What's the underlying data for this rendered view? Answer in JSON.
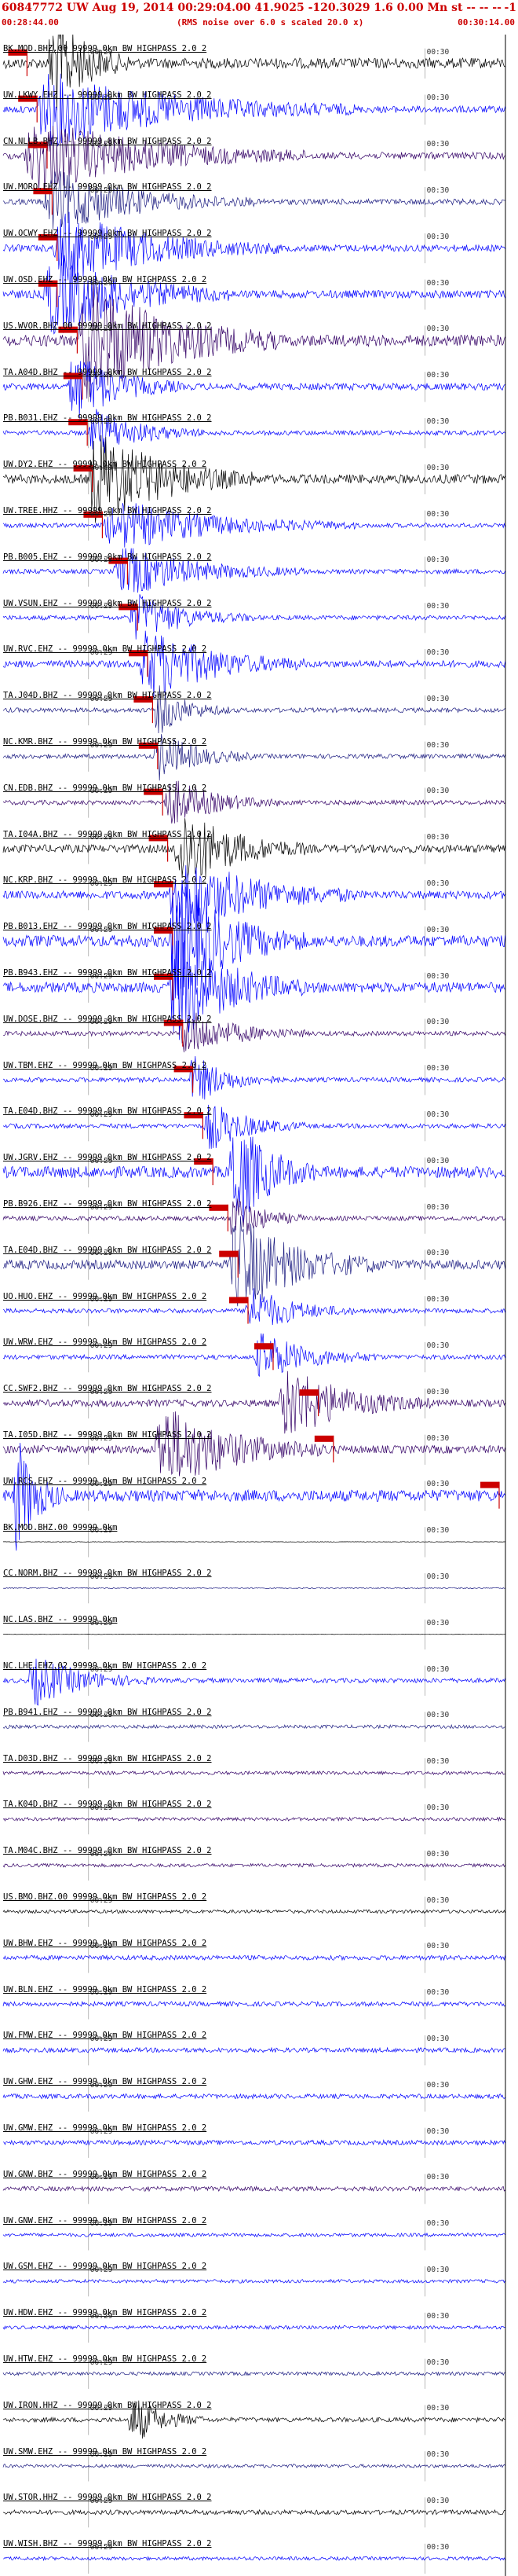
{
  "header": {
    "title": "60847772 UW Aug 19, 2014 00:29:04.00   41.9025 -120.3029   1.6 0.00 Mn st -- -- --",
    "right_mark": "-1",
    "start_time": "00:28:44.00",
    "noise_note": "(RMS noise over 6.0 s scaled 20.0 x)",
    "end_time": "00:30:14.00"
  },
  "tick_labels": {
    "mark1": "00:29",
    "mark2": "00:30"
  },
  "colors": {
    "black": "#000000",
    "blue": "#0000ff",
    "purple": "#330066",
    "navy": "#1a1a80",
    "pick": "#cc0000",
    "grid": "#000000"
  },
  "traces": [
    {
      "label": "BK.MOD.BHZ.00 99999.0km BW  HIGHPASS  2.0  2",
      "color": "black",
      "amp": 0.45,
      "event": [
        0.09,
        0.25
      ],
      "pick": 0.01
    },
    {
      "label": "UW.LKWY.EHZ -- 99999.0km BW  HIGHPASS  2.0  2",
      "color": "blue",
      "amp": 0.3,
      "event": [
        0.06,
        0.7
      ],
      "pick": 0.03
    },
    {
      "label": "CN.NLLB.BHZ -- 99999.0km BW  HIGHPASS  2.0  2",
      "color": "purple",
      "amp": 0.3,
      "event": [
        0.04,
        0.6
      ],
      "pick": 0.05
    },
    {
      "label": "UW.MORO.EHZ -- 99999.0km BW  HIGHPASS  2.0  2",
      "color": "navy",
      "amp": 0.25,
      "event": [
        0.08,
        0.5
      ],
      "pick": 0.06
    },
    {
      "label": "UW.OCWY.EHZ -- 99999.0km BW  HIGHPASS  2.0  2",
      "color": "blue",
      "amp": 0.3,
      "event": [
        0.1,
        0.55
      ],
      "pick": 0.07
    },
    {
      "label": "UW.OSD.EHZ -- 99999.0km BW  HIGHPASS  2.0  2",
      "color": "blue",
      "amp": 0.35,
      "event": [
        0.08,
        0.45
      ],
      "pick": 0.07
    },
    {
      "label": "US.WVOR.BHZ.00 99999.0km BW  HIGHPASS  2.0  2",
      "color": "purple",
      "amp": 0.5,
      "event": [
        0.15,
        0.55
      ],
      "pick": 0.11
    },
    {
      "label": "TA.A04D.BHZ -- 99999.0km BW  HIGHPASS  2.0  2",
      "color": "blue",
      "amp": 0.3,
      "event": [
        0.13,
        0.35
      ],
      "pick": 0.12
    },
    {
      "label": "PB.B031.EHZ -- 99999.0km BW  HIGHPASS  2.0  2",
      "color": "blue",
      "amp": 0.2,
      "event": [
        0.17,
        0.4
      ],
      "pick": 0.13
    },
    {
      "label": "UW.DY2.EHZ -- 99999.0km BW  HIGHPASS  2.0  2",
      "color": "black",
      "amp": 0.4,
      "event": [
        0.17,
        0.5
      ],
      "pick": 0.14
    },
    {
      "label": "UW.TREE.HHZ -- 99999.0km BW  HIGHPASS  2.0  2",
      "color": "blue",
      "amp": 0.2,
      "event": [
        0.2,
        0.7
      ],
      "pick": 0.16
    },
    {
      "label": "PB.B005.EHZ -- 99999.0km BW  HIGHPASS  2.0  2",
      "color": "blue",
      "amp": 0.2,
      "event": [
        0.22,
        0.6
      ],
      "pick": 0.21
    },
    {
      "label": "UW.VSUN.EHZ -- 99999.0km BW  HIGHPASS  2.0  2",
      "color": "blue",
      "amp": 0.2,
      "event": [
        0.25,
        0.5
      ],
      "pick": 0.23
    },
    {
      "label": "UW.RVC.EHZ -- 99999.0km BW  HIGHPASS  2.0  2",
      "color": "blue",
      "amp": 0.3,
      "event": [
        0.27,
        0.6
      ],
      "pick": 0.25
    },
    {
      "label": "TA.J04D.BHZ -- 99999.0km BW  HIGHPASS  2.0  2",
      "color": "navy",
      "amp": 0.2,
      "event": [
        0.3,
        0.45
      ],
      "pick": 0.26
    },
    {
      "label": "NC.KMR.BHZ -- 99999.0km BW  HIGHPASS  2.0  2",
      "color": "navy",
      "amp": 0.2,
      "event": [
        0.3,
        0.5
      ],
      "pick": 0.27
    },
    {
      "label": "CN.EDB.BHZ -- 99999.0km BW  HIGHPASS  2.0  2",
      "color": "purple",
      "amp": 0.2,
      "event": [
        0.32,
        0.55
      ],
      "pick": 0.28
    },
    {
      "label": "TA.I04A.BHZ -- 99999.0km BW  HIGHPASS  2.0  2",
      "color": "black",
      "amp": 0.35,
      "event": [
        0.34,
        0.6
      ],
      "pick": 0.29
    },
    {
      "label": "NC.KRP.BHZ -- 99999.0km BW  HIGHPASS  2.0  2",
      "color": "blue",
      "amp": 0.35,
      "event": [
        0.33,
        0.7
      ],
      "pick": 0.3
    },
    {
      "label": "PB.B013.EHZ -- 99999.0km BW  HIGHPASS  2.0  2",
      "color": "blue",
      "amp": 0.5,
      "event": [
        0.33,
        0.6
      ],
      "pick": 0.3
    },
    {
      "label": "PB.B943.EHZ -- 99999.0km BW  HIGHPASS  2.0  2",
      "color": "blue",
      "amp": 0.45,
      "event": [
        0.33,
        0.6
      ],
      "pick": 0.3
    },
    {
      "label": "UW.DOSE.BHZ -- 99999.0km BW  HIGHPASS  2.0  2",
      "color": "purple",
      "amp": 0.2,
      "event": [
        0.35,
        0.6
      ],
      "pick": 0.32
    },
    {
      "label": "UW.TBM.EHZ -- 99999.0km BW  HIGHPASS  2.0  2",
      "color": "blue",
      "amp": 0.2,
      "event": [
        0.37,
        0.55
      ],
      "pick": 0.34
    },
    {
      "label": "TA.E04D.BHZ -- 99999.0km BW  HIGHPASS  2.0  2",
      "color": "blue",
      "amp": 0.2,
      "event": [
        0.4,
        0.6
      ],
      "pick": 0.36
    },
    {
      "label": "UW.JGRV.EHZ -- 99999.0km BW  HIGHPASS  2.0  2",
      "color": "blue",
      "amp": 0.5,
      "event": [
        0.45,
        0.62
      ],
      "pick": 0.38
    },
    {
      "label": "PB.B926.EHZ -- 99999.0km BW  HIGHPASS  2.0  2",
      "color": "purple",
      "amp": 0.2,
      "event": [
        0.45,
        0.6
      ],
      "pick": 0.41
    },
    {
      "label": "TA.E04D.BHZ -- 99999.0km BW  HIGHPASS  2.0  2",
      "color": "navy",
      "amp": 0.4,
      "event": [
        0.45,
        0.75
      ],
      "pick": 0.43
    },
    {
      "label": "UO.HUO.EHZ -- 99999.0km BW  HIGHPASS  2.0  2",
      "color": "blue",
      "amp": 0.2,
      "event": [
        0.48,
        0.7
      ],
      "pick": 0.45
    },
    {
      "label": "UW.WRW.EHZ -- 99999.0km BW  HIGHPASS  2.0  2",
      "color": "blue",
      "amp": 0.2,
      "event": [
        0.5,
        0.75
      ],
      "pick": 0.5
    },
    {
      "label": "CC.SWF2.BHZ -- 99999.0km BW  HIGHPASS  2.0  2",
      "color": "purple",
      "amp": 0.3,
      "event": [
        0.55,
        0.85
      ],
      "pick": 0.59
    },
    {
      "label": "TA.I05D.BHZ -- 99999.0km BW  HIGHPASS  2.0  2",
      "color": "purple",
      "amp": 0.35,
      "event": [
        0.3,
        0.65
      ],
      "pick": 0.62
    },
    {
      "label": "UW.RCS.EHZ -- 99999.0km BW  HIGHPASS  2.0  2",
      "color": "blue",
      "amp": 0.5,
      "event": [
        0.02,
        0.12
      ],
      "pick": 0.95
    },
    {
      "label": "BK.MOD.BHZ.00 99999.0km",
      "color": "black",
      "amp": 0.02,
      "event": null,
      "pick": null
    },
    {
      "label": "CC.NORM.BHZ -- 99999.0km BW  HIGHPASS  2.0  2",
      "color": "navy",
      "amp": 0.05,
      "event": null,
      "pick": null
    },
    {
      "label": "NC.LAS.BHZ -- 99999.0km",
      "color": "black",
      "amp": 0.02,
      "event": null,
      "pick": null
    },
    {
      "label": "NC.LHE.EHZ.02 99999.0km BW  HIGHPASS  2.0  2",
      "color": "blue",
      "amp": 0.2,
      "event": [
        0.05,
        0.3
      ],
      "pick": null
    },
    {
      "label": "PB.B941.EHZ -- 99999.0km BW  HIGHPASS  2.0  2",
      "color": "navy",
      "amp": 0.15,
      "event": null,
      "pick": null
    },
    {
      "label": "TA.D03D.BHZ -- 99999.0km BW  HIGHPASS  2.0  2",
      "color": "purple",
      "amp": 0.15,
      "event": null,
      "pick": null
    },
    {
      "label": "TA.K04D.BHZ -- 99999.0km BW  HIGHPASS  2.0  2",
      "color": "purple",
      "amp": 0.15,
      "event": null,
      "pick": null
    },
    {
      "label": "TA.M04C.BHZ -- 99999.0km BW  HIGHPASS  2.0  2",
      "color": "purple",
      "amp": 0.15,
      "event": null,
      "pick": null
    },
    {
      "label": "US.BMO.BHZ.00 99999.0km BW  HIGHPASS  2.0  2",
      "color": "black",
      "amp": 0.15,
      "event": null,
      "pick": null
    },
    {
      "label": "UW.BHW.EHZ -- 99999.0km BW  HIGHPASS  2.0  2",
      "color": "blue",
      "amp": 0.2,
      "event": null,
      "pick": null
    },
    {
      "label": "UW.BLN.EHZ -- 99999.0km BW  HIGHPASS  2.0  2",
      "color": "blue",
      "amp": 0.2,
      "event": null,
      "pick": null
    },
    {
      "label": "UW.FMW.EHZ -- 99999.0km BW  HIGHPASS  2.0  2",
      "color": "blue",
      "amp": 0.2,
      "event": null,
      "pick": null
    },
    {
      "label": "UW.GHW.EHZ -- 99999.0km BW  HIGHPASS  2.0  2",
      "color": "blue",
      "amp": 0.2,
      "event": null,
      "pick": null
    },
    {
      "label": "UW.GMW.EHZ -- 99999.0km BW  HIGHPASS  2.0  2",
      "color": "blue",
      "amp": 0.2,
      "event": null,
      "pick": null
    },
    {
      "label": "UW.GNW.BHZ -- 99999.0km BW  HIGHPASS  2.0  2",
      "color": "purple",
      "amp": 0.2,
      "event": null,
      "pick": null
    },
    {
      "label": "UW.GNW.EHZ -- 99999.0km BW  HIGHPASS  2.0  2",
      "color": "blue",
      "amp": 0.15,
      "event": null,
      "pick": null
    },
    {
      "label": "UW.GSM.EHZ -- 99999.0km BW  HIGHPASS  2.0  2",
      "color": "blue",
      "amp": 0.15,
      "event": null,
      "pick": null
    },
    {
      "label": "UW.HDW.EHZ -- 99999.0km BW  HIGHPASS  2.0  2",
      "color": "blue",
      "amp": 0.15,
      "event": null,
      "pick": null
    },
    {
      "label": "UW.HTW.EHZ -- 99999.0km BW  HIGHPASS  2.0  2",
      "color": "navy",
      "amp": 0.15,
      "event": null,
      "pick": null
    },
    {
      "label": "UW.IRON.HHZ -- 99999.0km BW  HIGHPASS  2.0  2",
      "color": "black",
      "amp": 0.2,
      "event": [
        0.25,
        0.4
      ],
      "pick": null
    },
    {
      "label": "UW.SMW.EHZ -- 99999.0km BW  HIGHPASS  2.0  2",
      "color": "navy",
      "amp": 0.15,
      "event": null,
      "pick": null
    },
    {
      "label": "UW.STOR.HHZ -- 99999.0km BW  HIGHPASS  2.0  2",
      "color": "black",
      "amp": 0.2,
      "event": null,
      "pick": null
    },
    {
      "label": "UW.WISH.BHZ -- 99999.0km BW  HIGHPASS  2.0  2",
      "color": "blue",
      "amp": 0.15,
      "event": null,
      "pick": null
    }
  ]
}
